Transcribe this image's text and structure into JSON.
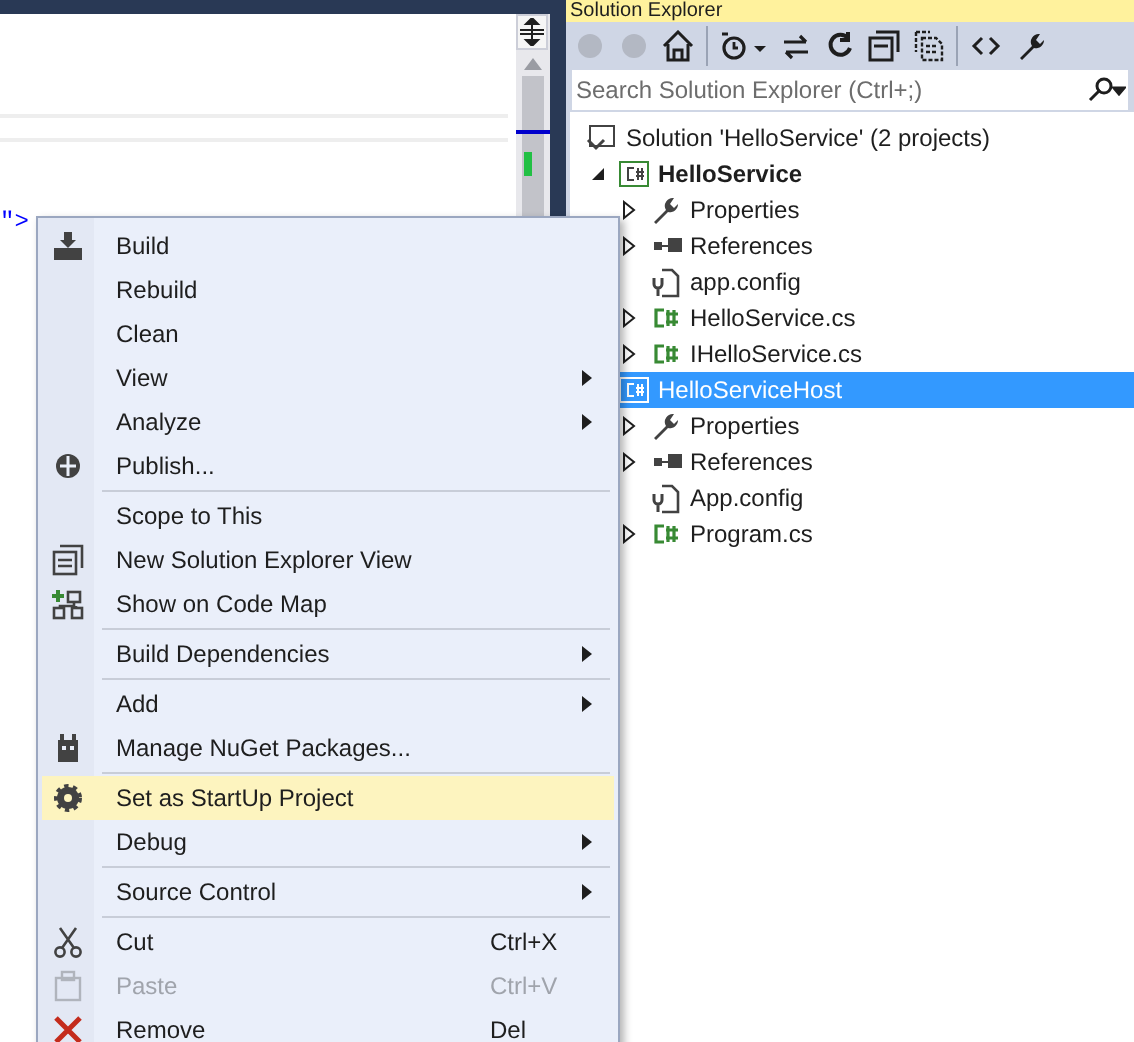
{
  "editor": {
    "code_fragment": "\">"
  },
  "solution_explorer": {
    "title": "Solution Explorer",
    "search": {
      "placeholder": "Search Solution Explorer (Ctrl+;)"
    },
    "tree": [
      {
        "label": "Solution 'HelloService' (2 projects)",
        "kind": "solution",
        "selected": false,
        "children": [
          {
            "label": "HelloService",
            "kind": "project",
            "selected": false,
            "bold": true,
            "expanded": true,
            "children": [
              {
                "label": "Properties",
                "kind": "properties",
                "selected": false,
                "has_children": true
              },
              {
                "label": "References",
                "kind": "references",
                "selected": false,
                "has_children": true
              },
              {
                "label": "app.config",
                "kind": "config",
                "selected": false,
                "has_children": false
              },
              {
                "label": "HelloService.cs",
                "kind": "csharp",
                "selected": false,
                "has_children": true
              },
              {
                "label": "IHelloService.cs",
                "kind": "csharp",
                "selected": false,
                "has_children": true
              }
            ]
          },
          {
            "label": "HelloServiceHost",
            "kind": "project",
            "selected": true,
            "bold": false,
            "children": [
              {
                "label": "Properties",
                "kind": "properties",
                "selected": false,
                "has_children": true
              },
              {
                "label": "References",
                "kind": "references",
                "selected": false,
                "has_children": true
              },
              {
                "label": "App.config",
                "kind": "config",
                "selected": false,
                "has_children": false
              },
              {
                "label": "Program.cs",
                "kind": "csharp",
                "selected": false,
                "has_children": true
              }
            ]
          }
        ]
      }
    ]
  },
  "context_menu": [
    {
      "kind": "item",
      "label": "Build",
      "submenu": false,
      "selected": false,
      "disabled": false
    },
    {
      "kind": "item",
      "label": "Rebuild",
      "submenu": false,
      "selected": false,
      "disabled": false
    },
    {
      "kind": "item",
      "label": "Clean",
      "submenu": false,
      "selected": false,
      "disabled": false
    },
    {
      "kind": "item",
      "label": "View",
      "submenu": true,
      "selected": false,
      "disabled": false
    },
    {
      "kind": "item",
      "label": "Analyze",
      "submenu": true,
      "selected": false,
      "disabled": false
    },
    {
      "kind": "item",
      "label": "Publish...",
      "submenu": false,
      "selected": false,
      "disabled": false
    },
    {
      "kind": "separator"
    },
    {
      "kind": "item",
      "label": "Scope to This",
      "submenu": false,
      "selected": false,
      "disabled": false
    },
    {
      "kind": "item",
      "label": "New Solution Explorer View",
      "submenu": false,
      "selected": false,
      "disabled": false
    },
    {
      "kind": "item",
      "label": "Show on Code Map",
      "submenu": false,
      "selected": false,
      "disabled": false
    },
    {
      "kind": "separator"
    },
    {
      "kind": "item",
      "label": "Build Dependencies",
      "submenu": true,
      "selected": false,
      "disabled": false
    },
    {
      "kind": "separator"
    },
    {
      "kind": "item",
      "label": "Add",
      "submenu": true,
      "selected": false,
      "disabled": false
    },
    {
      "kind": "item",
      "label": "Manage NuGet Packages...",
      "submenu": false,
      "selected": false,
      "disabled": false
    },
    {
      "kind": "separator"
    },
    {
      "kind": "item",
      "label": "Set as StartUp Project",
      "submenu": false,
      "selected": true,
      "disabled": false
    },
    {
      "kind": "item",
      "label": "Debug",
      "submenu": true,
      "selected": false,
      "disabled": false
    },
    {
      "kind": "separator"
    },
    {
      "kind": "item",
      "label": "Source Control",
      "submenu": true,
      "selected": false,
      "disabled": false
    },
    {
      "kind": "separator"
    },
    {
      "kind": "item",
      "label": "Cut",
      "shortcut": "Ctrl+X",
      "submenu": false,
      "selected": false,
      "disabled": false
    },
    {
      "kind": "item",
      "label": "Paste",
      "shortcut": "Ctrl+V",
      "submenu": false,
      "selected": false,
      "disabled": true
    },
    {
      "kind": "item",
      "label": "Remove",
      "shortcut": "Del",
      "submenu": false,
      "selected": false,
      "disabled": false
    }
  ]
}
